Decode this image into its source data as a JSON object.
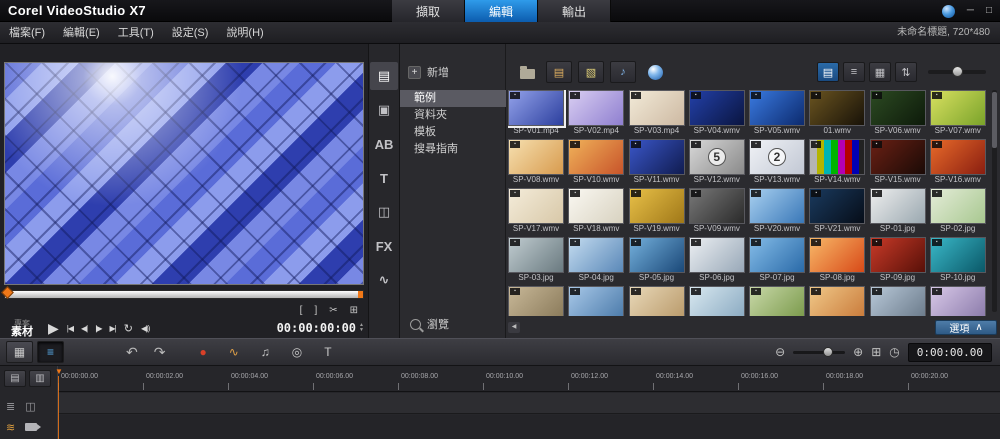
{
  "titlebar": {
    "logo": "Corel VideoStudio X7",
    "tabs": [
      {
        "name": "tab-capture",
        "label": "擷取",
        "active": false
      },
      {
        "name": "tab-edit",
        "label": "編輯",
        "active": true
      },
      {
        "name": "tab-share",
        "label": "輸出",
        "active": false
      }
    ],
    "window_icons": [
      {
        "name": "corel-guide-ball-icon",
        "type": "ball"
      },
      {
        "name": "minimize-icon",
        "glyph": "─"
      },
      {
        "name": "restore-icon",
        "glyph": "□"
      }
    ]
  },
  "menubar": {
    "items": [
      {
        "name": "menu-file",
        "label": "檔案(F)"
      },
      {
        "name": "menu-edit",
        "label": "編輯(E)"
      },
      {
        "name": "menu-tools",
        "label": "工具(T)"
      },
      {
        "name": "menu-settings",
        "label": "設定(S)"
      },
      {
        "name": "menu-help",
        "label": "說明(H)"
      }
    ],
    "project_label": "未命名標題, 720*480"
  },
  "preview": {
    "mode_top": "專案",
    "mode_bottom": "素材",
    "timecode": "00:00:00:00",
    "stepper_up": "▲",
    "stepper_down": "▼",
    "transport": [
      {
        "name": "play-button",
        "glyph": "▶",
        "size": "big"
      },
      {
        "name": "home-button",
        "glyph": "|◀",
        "size": "sm"
      },
      {
        "name": "prev-frame-button",
        "glyph": "◀|",
        "size": "sm"
      },
      {
        "name": "next-frame-button",
        "glyph": "|▶",
        "size": "sm"
      },
      {
        "name": "end-button",
        "glyph": "▶|",
        "size": "sm"
      },
      {
        "name": "repeat-button",
        "glyph": "↻",
        "size": "md"
      },
      {
        "name": "volume-button",
        "glyph": "◀))",
        "size": "sm"
      }
    ],
    "trim": [
      {
        "name": "mark-in-button",
        "glyph": "["
      },
      {
        "name": "mark-out-button",
        "glyph": "]"
      },
      {
        "name": "split-clip-button",
        "glyph": "✂"
      },
      {
        "name": "enlarge-preview-button",
        "glyph": "⊞"
      }
    ]
  },
  "nav_strip": [
    {
      "name": "nav-media",
      "glyph": "▤",
      "active": true
    },
    {
      "name": "nav-instant-project",
      "glyph": "▣",
      "active": false
    },
    {
      "name": "nav-transition",
      "glyph": "AB",
      "active": false
    },
    {
      "name": "nav-title",
      "glyph": "T",
      "active": false
    },
    {
      "name": "nav-graphic",
      "glyph": "◫",
      "active": false
    },
    {
      "name": "nav-filter",
      "glyph": "FX",
      "active": false
    },
    {
      "name": "nav-motion",
      "glyph": "∿",
      "active": false
    }
  ],
  "library": {
    "add_icon": "+",
    "add_label": "新增",
    "nav_items": [
      {
        "name": "gallery-samples",
        "label": "範例",
        "selected": true
      },
      {
        "name": "gallery-folder",
        "label": "資料夾",
        "selected": false
      },
      {
        "name": "gallery-templates",
        "label": "模板",
        "selected": false
      },
      {
        "name": "gallery-guide",
        "label": "搜尋指南",
        "selected": false
      }
    ],
    "browse_label": "瀏覽",
    "scroll_left_glyph": "◀",
    "toolbar": {
      "left": [
        {
          "name": "up-one-level-button",
          "type": "folder",
          "plain": true
        },
        {
          "name": "filter-video-button",
          "glyph": "▤",
          "color": "#e0b060"
        },
        {
          "name": "filter-photo-button",
          "glyph": "▧",
          "color": "#e0d078"
        },
        {
          "name": "filter-audio-button",
          "glyph": "♪",
          "color": "#80b4e8"
        },
        {
          "name": "corel-guide-sphere-icon",
          "type": "sphere",
          "plain": true
        }
      ],
      "right": [
        {
          "name": "view-thumbnail-button",
          "glyph": "▤",
          "active": true
        },
        {
          "name": "view-list-button",
          "glyph": "≡",
          "active": false
        },
        {
          "name": "view-grid-button",
          "glyph": "▦",
          "active": false
        },
        {
          "name": "sort-button",
          "glyph": "⇅",
          "active": false
        }
      ]
    },
    "options_label": "選項",
    "options_chevron": "∧",
    "thumbnails": [
      {
        "label": "SP-V01.mp4",
        "c1": "#93a2ea",
        "c2": "#2c3f9e",
        "sel": true
      },
      {
        "label": "SP-V02.mp4",
        "c1": "#d9cef2",
        "c2": "#8f7fd0"
      },
      {
        "label": "SP-V03.mp4",
        "c1": "#f2ead8",
        "c2": "#cdb9a2"
      },
      {
        "label": "SP-V04.wmv",
        "c1": "#2340a8",
        "c2": "#0a1540"
      },
      {
        "label": "SP-V05.wmv",
        "c1": "#3a7ae0",
        "c2": "#0c2a6e"
      },
      {
        "label": "01.wmv",
        "c1": "#6a5420",
        "c2": "#181208"
      },
      {
        "label": "SP-V06.wmv",
        "c1": "#2c4a22",
        "c2": "#0d1a0a"
      },
      {
        "label": "SP-V07.wmv",
        "c1": "#d8e060",
        "c2": "#7aa32a"
      },
      {
        "label": "SP-V08.wmv",
        "c1": "#f6e0b0",
        "c2": "#d89b4e"
      },
      {
        "label": "SP-V10.wmv",
        "c1": "#f0b25a",
        "c2": "#c8542a"
      },
      {
        "label": "SP-V11.wmv",
        "c1": "#3a56c8",
        "c2": "#101c50"
      },
      {
        "label": "SP-V12.wmv",
        "c1": "#d8d8d8",
        "c2": "#8a8a8a",
        "overlay": "5"
      },
      {
        "label": "SP-V13.wmv",
        "c1": "#f0f2f6",
        "c2": "#c2c8d4",
        "overlay": "2"
      },
      {
        "label": "SP-V14.wmv",
        "bars": true
      },
      {
        "label": "SP-V15.wmv",
        "c1": "#6a2014",
        "c2": "#1a0a06"
      },
      {
        "label": "SP-V16.wmv",
        "c1": "#e86a2a",
        "c2": "#8a1e10"
      },
      {
        "label": "SP-V17.wmv",
        "c1": "#f4ecda",
        "c2": "#d8c8a8"
      },
      {
        "label": "SP-V18.wmv",
        "c1": "#faf8f2",
        "c2": "#d8d2c0"
      },
      {
        "label": "SP-V19.wmv",
        "c1": "#e8c048",
        "c2": "#a07818"
      },
      {
        "label": "SP-V09.wmv",
        "c1": "#787878",
        "c2": "#2a2a2a"
      },
      {
        "label": "SP-V20.wmv",
        "c1": "#a8d0f0",
        "c2": "#3a78b8"
      },
      {
        "label": "SP-V21.wmv",
        "c1": "#1a3a5e",
        "c2": "#060d18"
      },
      {
        "label": "SP-01.jpg",
        "c1": "#eeeeee",
        "c2": "#9aa8b0"
      },
      {
        "label": "SP-02.jpg",
        "c1": "#e4ecd8",
        "c2": "#a8c890"
      },
      {
        "label": "SP-03.jpg",
        "c1": "#c0ccd0",
        "c2": "#6a7a80"
      },
      {
        "label": "SP-04.jpg",
        "c1": "#c4dcf0",
        "c2": "#5a88b8"
      },
      {
        "label": "SP-05.jpg",
        "c1": "#74b0dc",
        "c2": "#1a4878"
      },
      {
        "label": "SP-06.jpg",
        "c1": "#eceff2",
        "c2": "#98a8b8"
      },
      {
        "label": "SP-07.jpg",
        "c1": "#84bce8",
        "c2": "#2a6aa8"
      },
      {
        "label": "SP-08.jpg",
        "c1": "#f8b868",
        "c2": "#d84a18"
      },
      {
        "label": "SP-09.jpg",
        "c1": "#c83a28",
        "c2": "#581008"
      },
      {
        "label": "SP-10.jpg",
        "c1": "#3ab8c8",
        "c2": "#0a5868"
      },
      {
        "label": "",
        "c1": "#c8b898",
        "c2": "#887858"
      },
      {
        "label": "",
        "c1": "#a8c8e8",
        "c2": "#4878a8"
      },
      {
        "label": "",
        "c1": "#e8d8b8",
        "c2": "#b89868"
      },
      {
        "label": "",
        "c1": "#d8e8f0",
        "c2": "#88a8c0"
      },
      {
        "label": "",
        "c1": "#c8d8a8",
        "c2": "#789848"
      },
      {
        "label": "",
        "c1": "#f0c888",
        "c2": "#c87838"
      },
      {
        "label": "",
        "c1": "#b8c8d8",
        "c2": "#687888"
      },
      {
        "label": "",
        "c1": "#d8c8e8",
        "c2": "#8878a8"
      }
    ]
  },
  "bottom_toolbar": {
    "views": [
      {
        "name": "storyboard-view-button",
        "glyph": "▦",
        "active": false
      },
      {
        "name": "timeline-view-button",
        "glyph": "≡",
        "active": true
      }
    ],
    "undo_glyph": "↶",
    "redo_glyph": "↷",
    "tools": [
      {
        "name": "record-capture-button",
        "glyph": "●",
        "color": "#d84028"
      },
      {
        "name": "sound-mixer-button",
        "glyph": "∿",
        "color": "#e0a048"
      },
      {
        "name": "auto-music-button",
        "glyph": "♫",
        "color": "#c8c8c8"
      },
      {
        "name": "motion-tracking-button",
        "glyph": "◎",
        "color": "#c8c8c8"
      },
      {
        "name": "subtitle-editor-button",
        "glyph": "T",
        "color": "#c8c8c8"
      }
    ],
    "zoom_out_glyph": "⊖",
    "zoom_in_glyph": "⊕",
    "fit_glyph": "⊞",
    "duration_glyph": "◷",
    "time_display": "0:00:00.00"
  },
  "timeline": {
    "playhead_glyph": "▼",
    "ruler_ticks": [
      "00:00:00.00",
      "00:00:02.00",
      "00:00:04.00",
      "00:00:06.00",
      "00:00:08.00",
      "00:00:10.00",
      "00:00:12.00",
      "00:00:14.00",
      "00:00:16.00",
      "00:00:18.00",
      "00:00:20.00"
    ],
    "gutter_buttons": [
      {
        "name": "track-manager-button",
        "glyph": "▤"
      },
      {
        "name": "show-all-tracks-button",
        "glyph": "▥"
      }
    ],
    "gutter_row1": [
      {
        "name": "ripple-edit-all-icon",
        "glyph": "≣"
      },
      {
        "name": "track-layout-icon",
        "glyph": "◫"
      }
    ],
    "gutter_row2": [
      {
        "name": "ripple-edit-icon",
        "glyph": "≋",
        "color": "#e0a040"
      },
      {
        "name": "video-track-icon",
        "type": "cam"
      }
    ]
  }
}
